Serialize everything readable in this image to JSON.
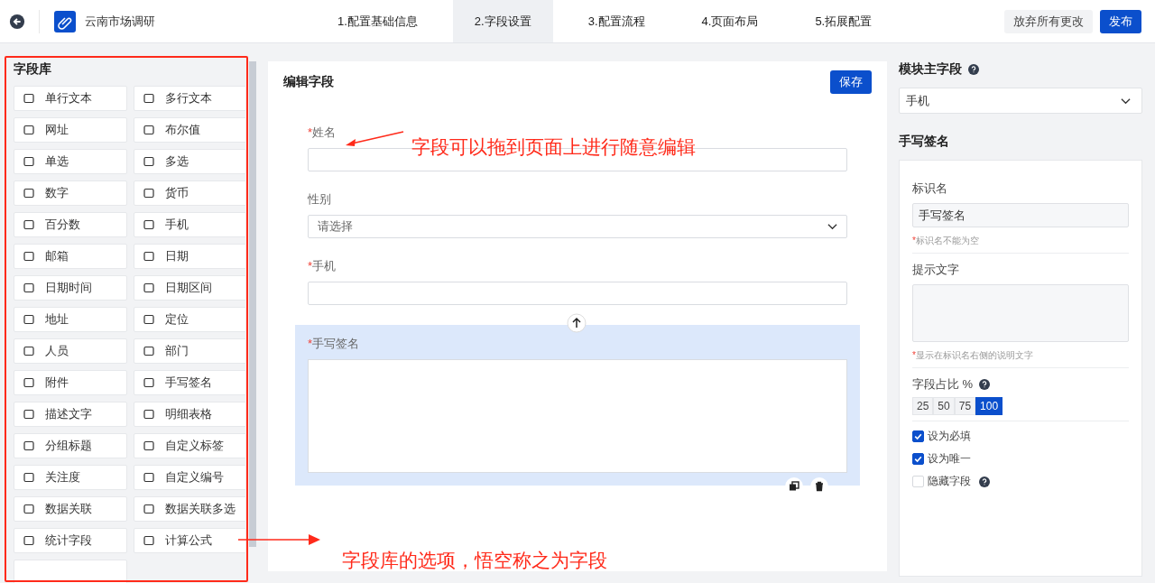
{
  "header": {
    "title": "云南市场调研",
    "steps": [
      {
        "label": "1.配置基础信息",
        "selected": false
      },
      {
        "label": "2.字段设置",
        "selected": true
      },
      {
        "label": "3.配置流程",
        "selected": false
      },
      {
        "label": "4.页面布局",
        "selected": false
      },
      {
        "label": "5.拓展配置",
        "selected": false
      }
    ],
    "discard_button": "放弃所有更改",
    "publish_button": "发布"
  },
  "field_library": {
    "title": "字段库",
    "items": [
      "单行文本",
      "多行文本",
      "网址",
      "布尔值",
      "单选",
      "多选",
      "数字",
      "货币",
      "百分数",
      "手机",
      "邮箱",
      "日期",
      "日期时间",
      "日期区间",
      "地址",
      "定位",
      "人员",
      "部门",
      "附件",
      "手写签名",
      "描述文字",
      "明细表格",
      "分组标题",
      "自定义标签",
      "关注度",
      "自定义编号",
      "数据关联",
      "数据关联多选",
      "统计字段",
      "计算公式"
    ]
  },
  "editor": {
    "title": "编辑字段",
    "save_button": "保存",
    "fields": [
      {
        "kind": "input",
        "mark": "*",
        "label": "姓名",
        "selected": false
      },
      {
        "kind": "select",
        "label": "性别",
        "placeholder": "请选择",
        "selected": false
      },
      {
        "kind": "input",
        "mark": "*",
        "label": "手机",
        "selected": false
      },
      {
        "kind": "signature",
        "mark": "*",
        "label": "手写签名",
        "selected": true
      }
    ]
  },
  "properties": {
    "main_field_label": "模块主字段",
    "main_field_value": "手机",
    "section_title": "手写签名",
    "name_label": "标识名",
    "name_value": "手写签名",
    "name_hint": "*标识名不能为空",
    "tip_label": "提示文字",
    "tip_hint": "*显示在标识名右侧的说明文字",
    "width_label": "字段占比 %",
    "width_options": [
      {
        "label": "25",
        "selected": false
      },
      {
        "label": "50",
        "selected": false
      },
      {
        "label": "75",
        "selected": false
      },
      {
        "label": "100",
        "selected": true
      }
    ],
    "options": [
      {
        "label": "设为必填",
        "checked": true,
        "help": false
      },
      {
        "label": "设为唯一",
        "checked": true,
        "help": false
      },
      {
        "label": "隐藏字段",
        "checked": false,
        "help": true
      }
    ]
  },
  "annotations": [
    "字段可以拖到页面上进行随意编辑",
    "字段库的选项，悟空称之为字段"
  ]
}
